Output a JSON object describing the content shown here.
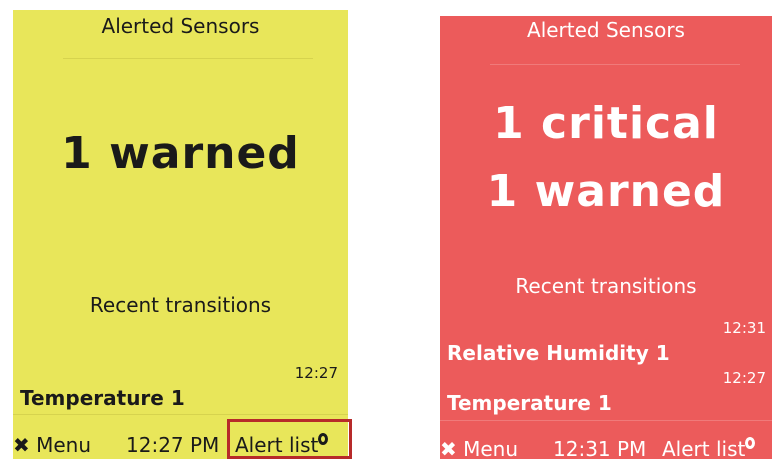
{
  "left_screen": {
    "title": "Alerted Sensors",
    "summary_line1": "1 warned",
    "recent_label": "Recent transitions",
    "transitions": [
      {
        "time": "12:27",
        "sensor": "Temperature 1"
      }
    ],
    "footer": {
      "menu": "Menu",
      "clock": "12:27 PM",
      "alert_list": "Alert list"
    },
    "background": "#e8e65a"
  },
  "right_screen": {
    "title": "Alerted Sensors",
    "summary_line1": "1 critical",
    "summary_line2": "1 warned",
    "recent_label": "Recent transitions",
    "transitions": [
      {
        "time": "12:31",
        "sensor": "Relative Humidity 1"
      },
      {
        "time": "12:27",
        "sensor": "Temperature 1"
      }
    ],
    "footer": {
      "menu": "Menu",
      "clock": "12:31 PM",
      "alert_list": "Alert list"
    },
    "background": "#ec5b5b"
  },
  "highlight_color": "#b72a2a"
}
